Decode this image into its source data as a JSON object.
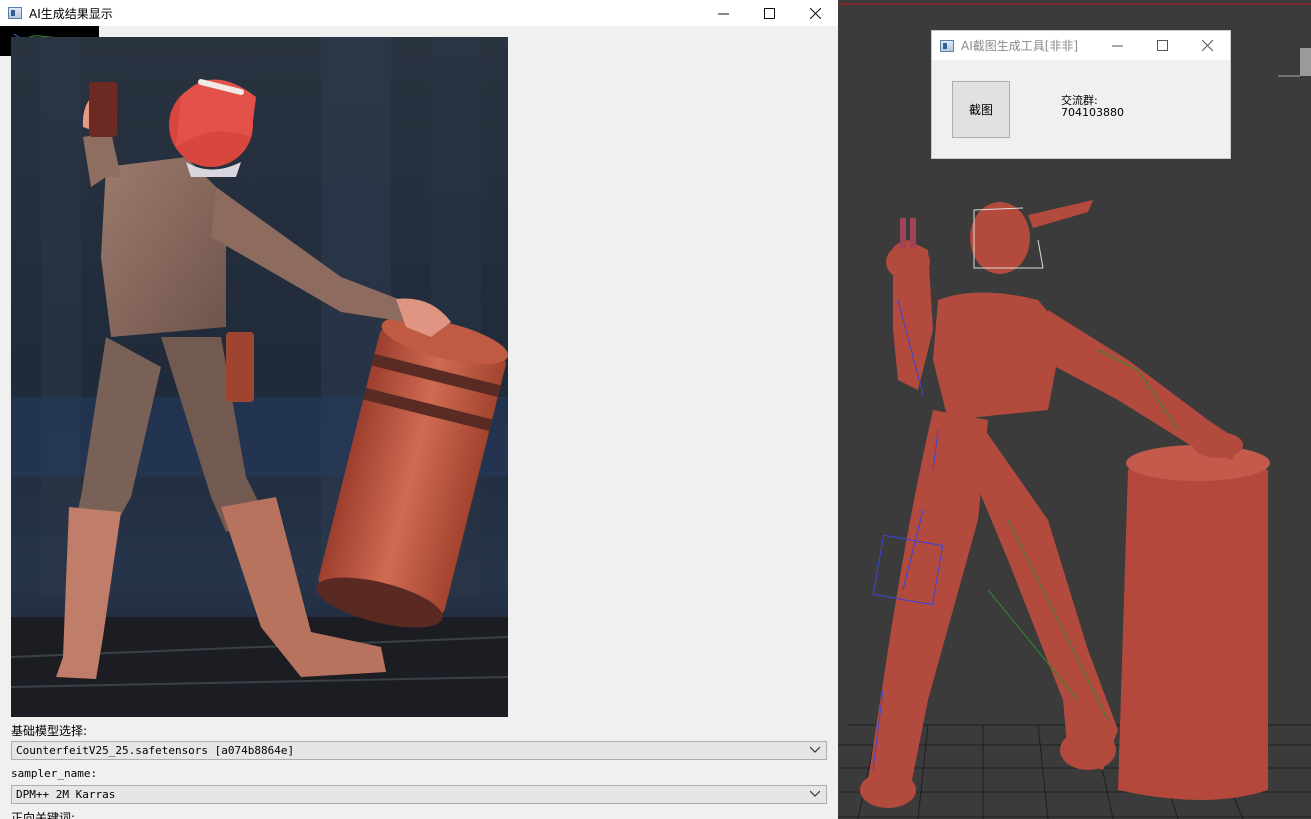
{
  "result_window": {
    "title": "AI生成结果显示",
    "controls": {
      "minimize": "minimize",
      "maximize": "maximize",
      "close": "close"
    },
    "model_label": "基础模型选择:",
    "model_value": "CounterfeitV25_25.safetensors [a074b8864e]",
    "sampler_label": "sampler_name:",
    "sampler_value": "DPM++ 2M Karras",
    "prompt_label": "正向关键词:"
  },
  "tool_window": {
    "title": "AI截图生成工具[非非]",
    "capture_button": "截图",
    "group_label": "交流群:",
    "group_number": "704103880"
  },
  "colors": {
    "window_bg": "#f0f0f0",
    "viewport_bg": "#3b3b3b",
    "model_clay": "#b5483d"
  },
  "icons": [
    "app-window-icon",
    "minimize-icon",
    "maximize-icon",
    "close-icon",
    "chevron-down-icon"
  ]
}
